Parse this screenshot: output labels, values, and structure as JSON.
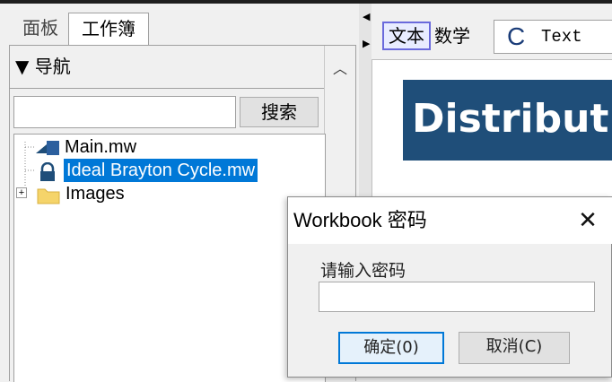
{
  "tabs": {
    "panel": "面板",
    "workbook": "工作簿"
  },
  "nav": {
    "title": "▼ 导航",
    "search_button": "搜索",
    "search_value": ""
  },
  "tree": [
    {
      "label": "Main.mw",
      "icon": "worksheet-icon"
    },
    {
      "label": "Ideal Brayton Cycle.mw",
      "icon": "lock-icon",
      "selected": true
    },
    {
      "label": "Images",
      "icon": "folder-icon",
      "expand": "+"
    }
  ],
  "toolbar": {
    "text_mode": "文本",
    "math_mode": "数学",
    "style_letter": "C",
    "style_name": "Text"
  },
  "document": {
    "heading": "Distribut"
  },
  "dialog": {
    "title": "Workbook 密码",
    "close": "✕",
    "prompt": "请输入密码",
    "password_value": "",
    "ok": "确定(0)",
    "cancel": "取消(C)"
  },
  "colors": {
    "selection": "#0078d7",
    "heading_bg": "#1f4e79",
    "mode_border": "#6a6adc"
  }
}
